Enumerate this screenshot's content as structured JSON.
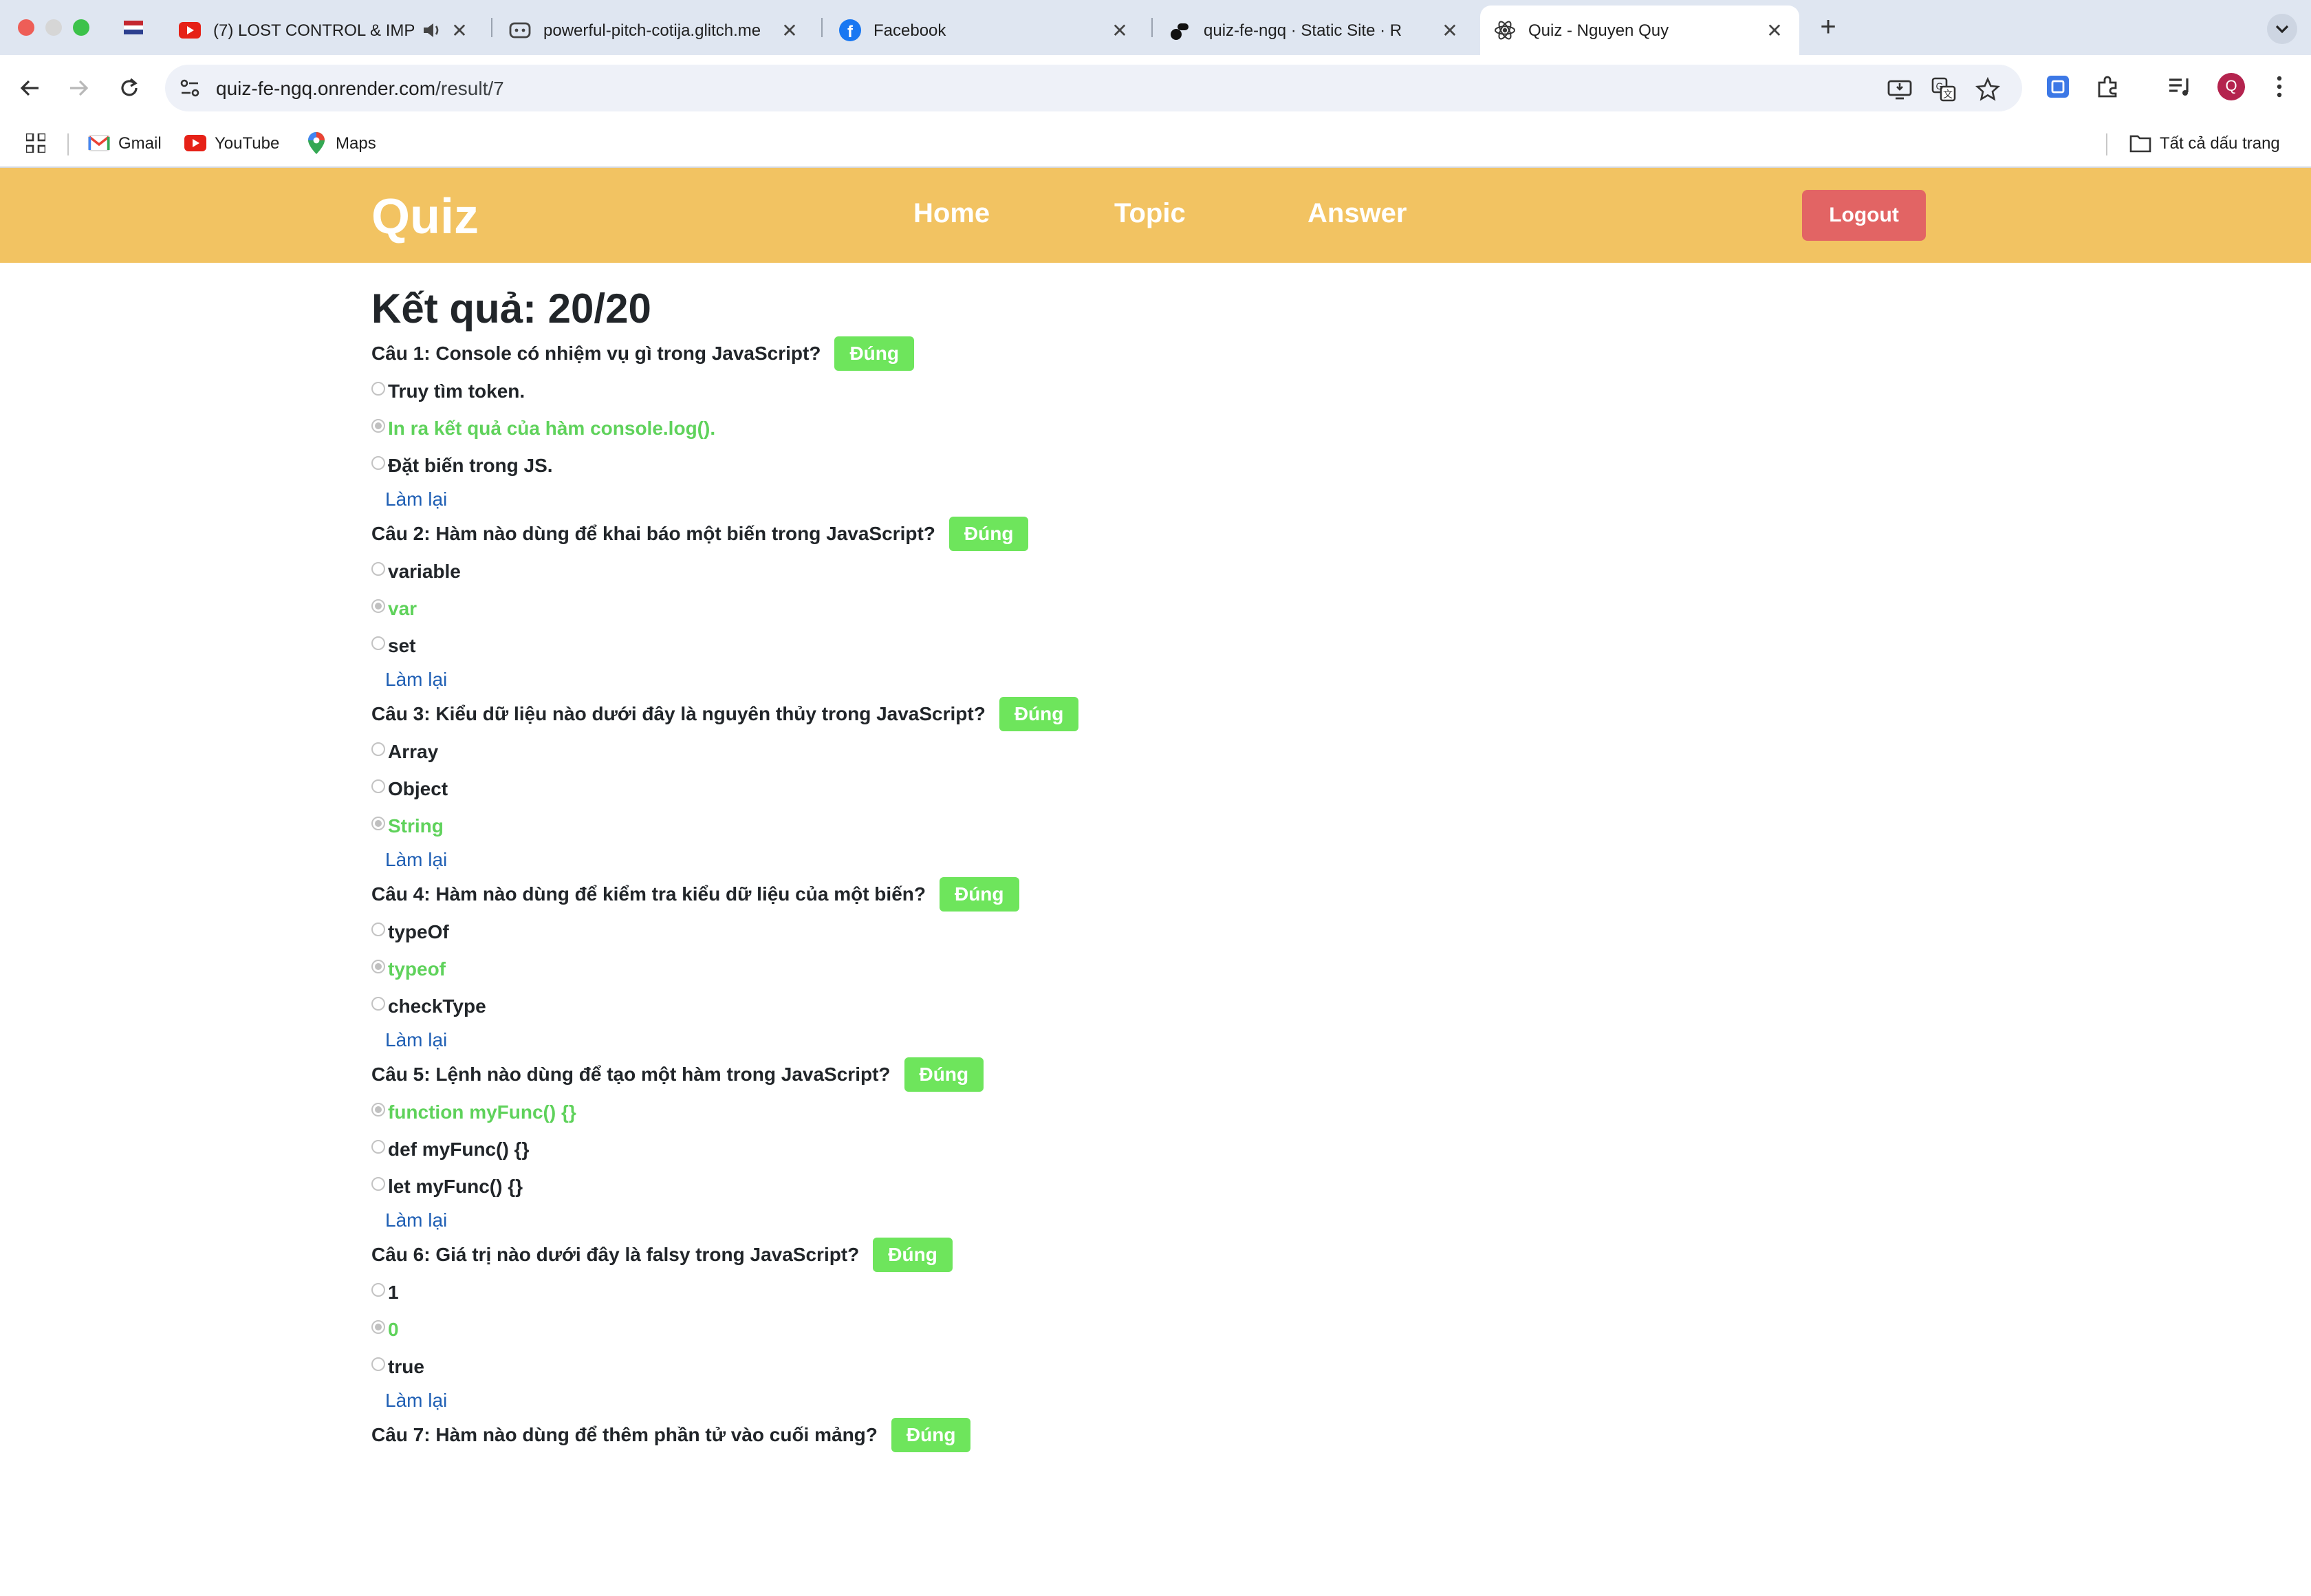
{
  "browser": {
    "tabs": [
      {
        "title": "(7) LOST CONTROL & IMP",
        "icon": "youtube-icon",
        "audio": true
      },
      {
        "title": "powerful-pitch-cotija.glitch.me",
        "icon": "glitch-icon"
      },
      {
        "title": "Facebook",
        "icon": "facebook-icon"
      },
      {
        "title": "quiz-fe-ngq · Static Site · R",
        "icon": "render-icon"
      },
      {
        "title": "Quiz - Nguyen Quy",
        "icon": "react-icon",
        "active": true
      }
    ],
    "url": {
      "host": "quiz-fe-ngq.onrender.com",
      "path": "/result/7"
    },
    "bookmarks": [
      {
        "label": "Gmail",
        "icon": "gmail-icon"
      },
      {
        "label": "YouTube",
        "icon": "youtube-icon"
      },
      {
        "label": "Maps",
        "icon": "maps-icon"
      }
    ],
    "all_bookmarks_label": "Tất cả dấu trang",
    "profile_initial": "Q"
  },
  "site": {
    "logo": "Quiz",
    "nav": [
      "Home",
      "Topic",
      "Answer"
    ],
    "logout_label": "Logout",
    "score_label": "Kết quả: 20/20",
    "correct_label": "Đúng",
    "retry_label": "Làm lại",
    "questions": [
      {
        "title": "Câu 1: Console có nhiệm vụ gì trong JavaScript?",
        "options": [
          "Truy tìm token.",
          "In ra kết quả của hàm console.log().",
          "Đặt biến trong JS."
        ],
        "selected": 1
      },
      {
        "title": "Câu 2: Hàm nào dùng để khai báo một biến trong JavaScript?",
        "options": [
          "variable",
          "var",
          "set"
        ],
        "selected": 1
      },
      {
        "title": "Câu 3: Kiểu dữ liệu nào dưới đây là nguyên thủy trong JavaScript?",
        "options": [
          "Array",
          "Object",
          "String"
        ],
        "selected": 2
      },
      {
        "title": "Câu 4: Hàm nào dùng để kiểm tra kiểu dữ liệu của một biến?",
        "options": [
          "typeOf",
          "typeof",
          "checkType"
        ],
        "selected": 1
      },
      {
        "title": "Câu 5: Lệnh nào dùng để tạo một hàm trong JavaScript?",
        "options": [
          "function myFunc() {}",
          "def myFunc() {}",
          "let myFunc() {}"
        ],
        "selected": 0
      },
      {
        "title": "Câu 6: Giá trị nào dưới đây là falsy trong JavaScript?",
        "options": [
          "1",
          "0",
          "true"
        ],
        "selected": 1
      },
      {
        "title": "Câu 7: Hàm nào dùng để thêm phần tử vào cuối mảng?",
        "options": [],
        "selected": null
      }
    ]
  },
  "colors": {
    "header": "#f2c362",
    "logout": "#e26464",
    "correct_badge": "#6ee55c",
    "correct_text": "#5fd25b",
    "link": "#1f5fb4"
  }
}
